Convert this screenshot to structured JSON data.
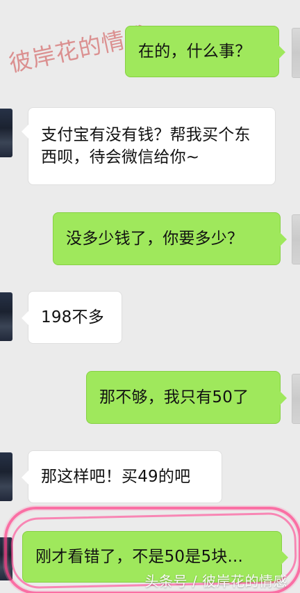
{
  "watermark": "彼岸花的情感",
  "footer_watermark": "头条号 / 彼岸花的情感",
  "messages": [
    {
      "side": "right",
      "text": "在的，什么事？"
    },
    {
      "side": "left",
      "text": "支付宝有没有钱？帮我买个东\n西呗，待会微信给你~"
    },
    {
      "side": "right",
      "text": "没多少钱了，你要多少？"
    },
    {
      "side": "left",
      "text": "198不多"
    },
    {
      "side": "right",
      "text": "那不够，我只有50了"
    },
    {
      "side": "left",
      "text": "那这样吧！买49的吧"
    },
    {
      "side": "right",
      "text": "刚才看错了，不是50是5块..."
    }
  ],
  "colors": {
    "background": "#ebebeb",
    "incoming_bubble": "#ffffff",
    "outgoing_bubble": "#9fe85c",
    "highlight": "#ff4d95"
  }
}
